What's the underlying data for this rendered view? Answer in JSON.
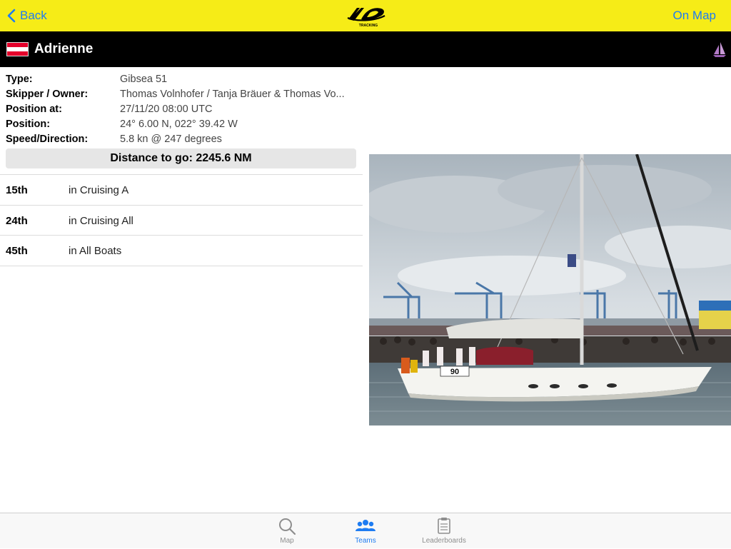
{
  "nav": {
    "back_label": "Back",
    "on_map_label": "On Map",
    "logo_text": "TRACKING"
  },
  "boat": {
    "name": "Adrienne",
    "flag_colors": [
      "#e4002b",
      "#ffffff",
      "#e4002b"
    ]
  },
  "details": [
    {
      "label": "Type:",
      "value": "Gibsea 51"
    },
    {
      "label": "Skipper / Owner:",
      "value": "Thomas Volnhofer / Tanja Bräuer & Thomas Vo..."
    },
    {
      "label": "Position at:",
      "value": "27/11/20 08:00 UTC"
    },
    {
      "label": "Position:",
      "value": "24° 6.00 N, 022° 39.42 W"
    },
    {
      "label": "Speed/Direction:",
      "value": "5.8 kn @ 247 degrees"
    }
  ],
  "distance_to_go": "Distance to go: 2245.6 NM",
  "rankings": [
    {
      "position": "15th",
      "description": "in Cruising A"
    },
    {
      "position": "24th",
      "description": "in Cruising All"
    },
    {
      "position": "45th",
      "description": "in All Boats"
    }
  ],
  "photo": {
    "sail_number": "90"
  },
  "tabs": [
    {
      "label": "Map",
      "icon": "search-icon"
    },
    {
      "label": "Teams",
      "icon": "people-icon",
      "active": true
    },
    {
      "label": "Leaderboards",
      "icon": "clipboard-icon"
    }
  ],
  "colors": {
    "header_yellow": "#f6ec17",
    "accent_blue": "#1e7cf2",
    "name_bar": "#000000"
  }
}
